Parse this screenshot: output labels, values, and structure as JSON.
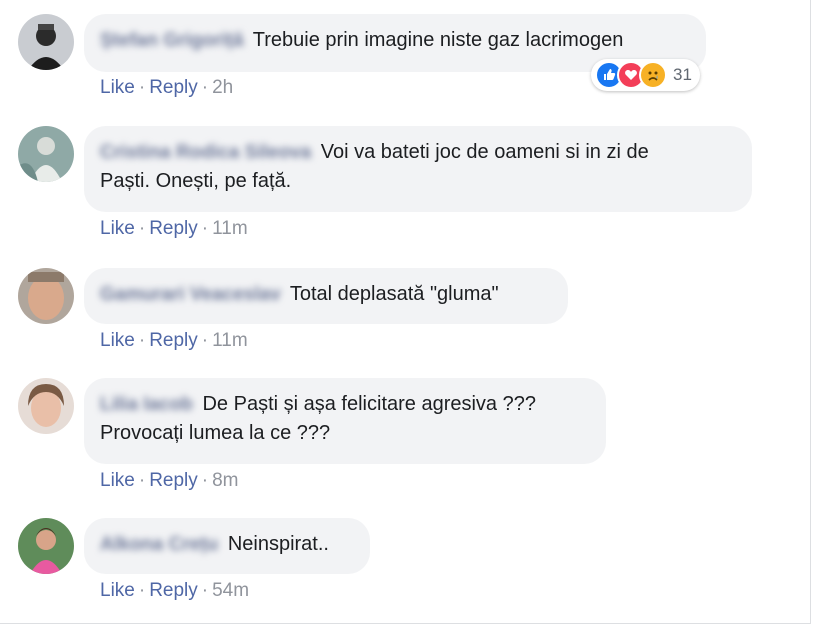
{
  "comments": [
    {
      "author": "Ștefan Grigoriță",
      "text": "Trebuie prin imagine niste gaz lacrimogen",
      "like": "Like",
      "reply": "Reply",
      "time": "2h",
      "reactions": {
        "icons": [
          "like-icon",
          "love-icon",
          "sad-icon"
        ],
        "count": "31"
      }
    },
    {
      "author": "Cristina Rodica Sileova",
      "text": "Voi va bateti joc de oameni si in zi de Paști. Onești, pe față.",
      "line1": "Voi va bateti joc de oameni si in zi de",
      "line2": "Paști. Onești, pe față.",
      "like": "Like",
      "reply": "Reply",
      "time": "11m"
    },
    {
      "author": "Gamurari Veaceslav",
      "text": "Total deplasată \"gluma\"",
      "like": "Like",
      "reply": "Reply",
      "time": "11m"
    },
    {
      "author": "Lilia Iacob",
      "line1": "De Paști și așa felicitare agresiva ???",
      "line2": "Provocați lumea la ce ???",
      "like": "Like",
      "reply": "Reply",
      "time": "8m"
    },
    {
      "author": "Alkona Crețu",
      "text": "Neinspirat..",
      "like": "Like",
      "reply": "Reply",
      "time": "54m"
    }
  ],
  "colors": {
    "bubble": "#f2f3f5",
    "link": "#4f67a6",
    "meta": "#90949c",
    "like_blue": "#1877f2",
    "love_red": "#f33e58",
    "sad_yellow": "#f7b125"
  }
}
